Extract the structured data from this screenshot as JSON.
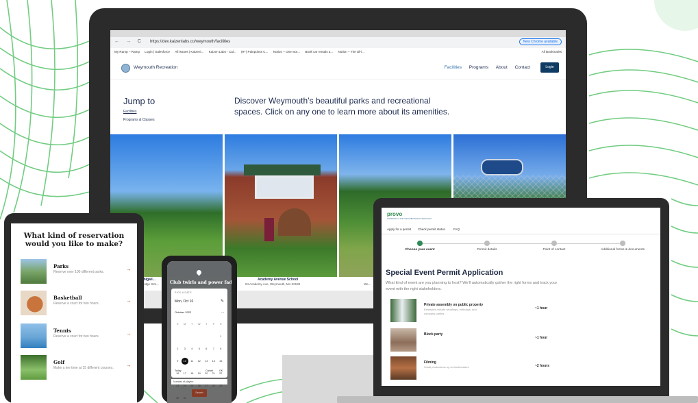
{
  "colors": {
    "stripes": "#59c46c",
    "site_navy": "#1d2b4f",
    "login_bg": "#0f3b63",
    "accent_link": "#2e6ea8",
    "tablet_arrow": "#c0582f",
    "step_active": "#2e8b57",
    "phone_cta": "#8a3b25"
  },
  "desktop": {
    "browser": {
      "url": "https://dev.kaizenlabs.co/weymouth/facilities",
      "update_button": "New Chrome available",
      "bookmarks": [
        "My Ramp – Ramp",
        "Login | Salesforce",
        "All issues | Kaizenl...",
        "Kaizen Labs - Cal...",
        "(9+) Painpoints C...",
        "Notion – One wor...",
        "Book car rentals a...",
        "Notion – The all-i..."
      ],
      "all_bookmarks": "All Bookmarks"
    },
    "site": {
      "title": "Weymouth Recreation",
      "nav": [
        "Facilities",
        "Programs",
        "About",
        "Contact"
      ],
      "login": "Login",
      "jump_to": "Jump to",
      "jump_links": [
        "Facilities",
        "Programs & Classes"
      ],
      "headline": "Discover Weymouth’s beautiful parks and recreational spaces. Click on any one to learn more about its amenities.",
      "facilities": [
        {
          "name": "Abigail...",
          "address": "Bridge Stre..."
        },
        {
          "name": "Academy Avenue School",
          "address": "94 Academy Ave, Weymouth, MA 02189"
        },
        {
          "name": "",
          "address": "We..."
        },
        {
          "name": "",
          "address": ""
        }
      ]
    }
  },
  "tablet": {
    "title": "What kind of reservation would you like to make?",
    "items": [
      {
        "name": "Parks",
        "desc": "Reserve over 100 different parks.",
        "icon": "park-photo"
      },
      {
        "name": "Basketball",
        "desc": "Reserve a court for two hours.",
        "icon": "basketball-photo"
      },
      {
        "name": "Tennis",
        "desc": "Reserve a court for two hours.",
        "icon": "tennis-photo"
      },
      {
        "name": "Golf",
        "desc": "Make a tee time at 15 different courses.",
        "icon": "golf-photo"
      }
    ],
    "arrow": "→"
  },
  "phone": {
    "title": "Club twirls and power fades",
    "pick_label": "PICK A DATE",
    "selected_date": "Mon, Oct 10",
    "month": "October 2022",
    "weekdays": [
      "S",
      "M",
      "T",
      "W",
      "T",
      "F",
      "S"
    ],
    "days": [
      "",
      "",
      "",
      "",
      "",
      "",
      "1",
      "2",
      "3",
      "4",
      "5",
      "6",
      "7",
      "8",
      "9",
      "10",
      "11",
      "12",
      "13",
      "14",
      "15",
      "16",
      "17",
      "18",
      "19",
      "20",
      "21",
      "22",
      "23",
      "24",
      "25",
      "26",
      "27",
      "28",
      "29",
      "30",
      "31"
    ],
    "selected_day": "10",
    "today": "Today",
    "cancel": "Cancel",
    "ok": "OK",
    "field": "Number of players",
    "cta": "Search"
  },
  "laptop": {
    "brand": "provo",
    "brand_sub": "COMMUNITY AND NEIGHBORHOOD SERVICES",
    "nav": [
      "Apply for a permit",
      "Check permit status",
      "FAQ"
    ],
    "steps": [
      "Choose your event",
      "Permit details",
      "Point of contact",
      "Additional forms & documents"
    ],
    "active_step": 0,
    "title": "Special Event Permit Application",
    "description": "What kind of event are you planning to host? We’ll automatically gather the right forms and track your event with the right stakeholders.",
    "events": [
      {
        "name": "Private assembly on public property",
        "desc": "Examples include weddings, birthdays, and company parties.",
        "time": "~1 hour"
      },
      {
        "name": "Block party",
        "desc": "",
        "time": "~1 hour"
      },
      {
        "name": "Filming",
        "desc": "Small productions up to blockbusters",
        "time": "~2 hours"
      }
    ]
  }
}
